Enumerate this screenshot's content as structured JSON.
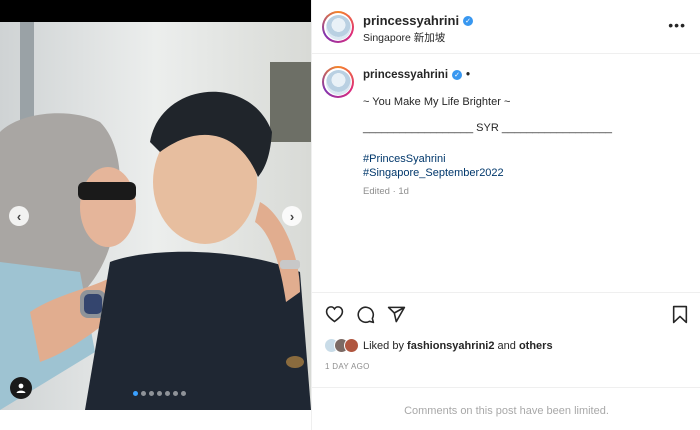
{
  "header": {
    "username": "princessyahrini",
    "location": "Singapore 新加坡",
    "more_icon": "more-horizontal-icon"
  },
  "caption": {
    "username": "princessyahrini",
    "bullet": "•",
    "line1": "~ You Make My Life Brighter ~",
    "line2": "__________________ SYR __________________",
    "hashtags": [
      "#PrincesSyahrini",
      "#Singapore_September2022"
    ],
    "edited": "Edited · 1d"
  },
  "actions": {
    "icons": [
      "heart-icon",
      "comment-icon",
      "share-icon",
      "bookmark-icon"
    ]
  },
  "likes": {
    "prefix": "Liked by",
    "user": "fashionsyahrini2",
    "and": "and",
    "others": "others"
  },
  "date": "1 DAY AGO",
  "comments_notice": "Comments on this post have been limited.",
  "carousel": {
    "slides": 7,
    "active_index": 0
  },
  "colors": {
    "verified": "#3897f0",
    "hashtag": "#00376b",
    "active_dot": "#3aa0ff"
  }
}
